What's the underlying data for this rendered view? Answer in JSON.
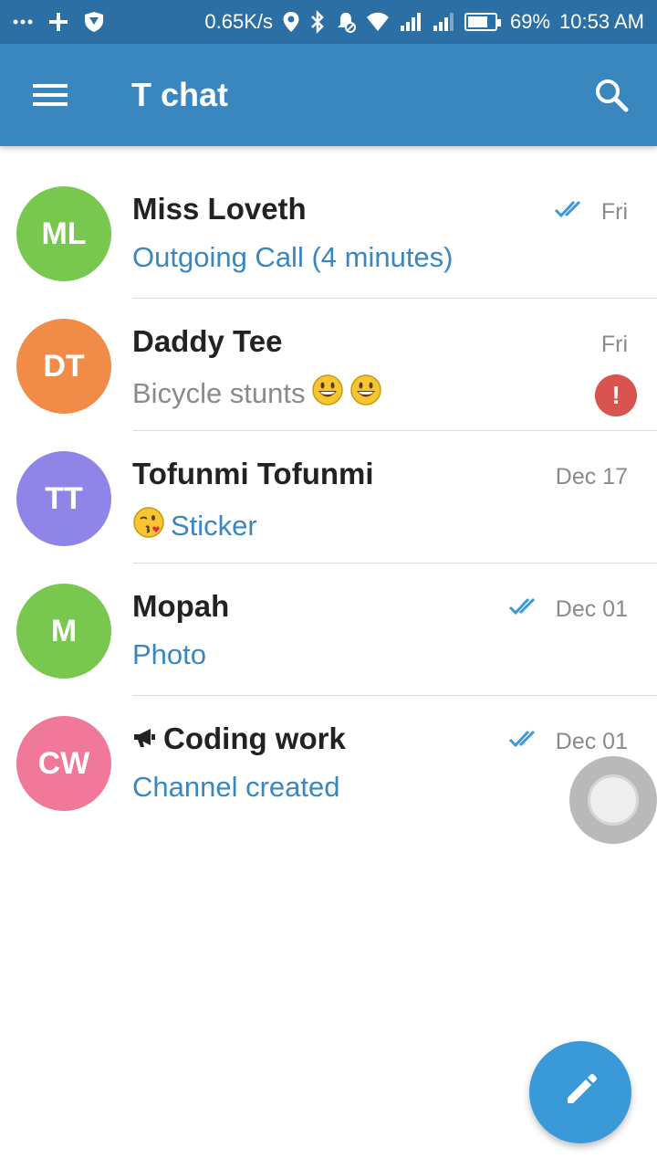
{
  "status_bar": {
    "network_speed": "0.65K/s",
    "battery": "69%",
    "time": "10:53 AM"
  },
  "app_bar": {
    "title": "T chat",
    "menu_icon": "hamburger-menu-icon",
    "search_icon": "search-icon"
  },
  "chats": [
    {
      "initials": "ML",
      "name": "Miss Loveth",
      "message": "Outgoing Call (4 minutes)",
      "date": "Fri",
      "avatar_color": "#78c850",
      "read": true
    },
    {
      "initials": "DT",
      "name": "Daddy Tee",
      "message": "Bicycle stunts",
      "date": "Fri",
      "avatar_color": "#f08c48",
      "failed_badge": "!"
    },
    {
      "initials": "TT",
      "name": "Tofunmi Tofunmi",
      "message": "Sticker",
      "date": "Dec 17",
      "avatar_color": "#8f85e8"
    },
    {
      "initials": "M",
      "name": "Mopah",
      "message": "Photo",
      "date": "Dec 01",
      "avatar_color": "#78c850",
      "read": true
    },
    {
      "initials": "CW",
      "name": "Coding work",
      "message": "Channel created",
      "date": "Dec 01",
      "avatar_color": "#f07898",
      "read": true,
      "channel_icon": "megaphone-icon"
    }
  ],
  "colors": {
    "status_bar": "#2c6fa5",
    "app_bar": "#3a87c0",
    "accent": "#3a87c0",
    "fab": "#3a99d8"
  },
  "fab_icon": "pencil-icon"
}
